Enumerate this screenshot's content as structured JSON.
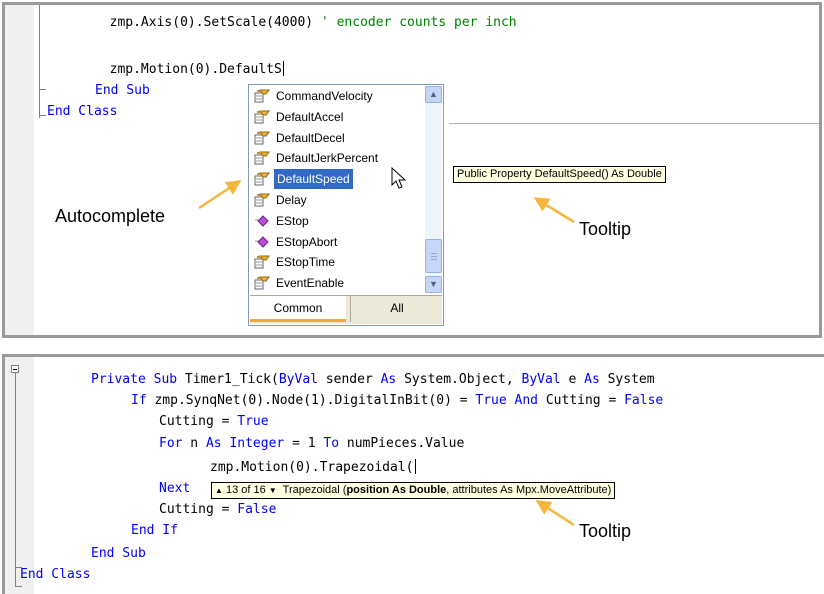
{
  "panel1": {
    "lines": [
      {
        "indent": "        ",
        "code": "zmp.Axis(0).SetScale(4000) ",
        "comment": "' encoder counts per inch"
      },
      {
        "indent": "        ",
        "code": "zmp.Motion(0).DefaultS",
        "comment": ""
      },
      {
        "kw": "End Sub"
      },
      {
        "kw": "End Class"
      }
    ],
    "autocomplete": {
      "items": [
        "CommandVelocity",
        "DefaultAccel",
        "DefaultDecel",
        "DefaultJerkPercent",
        "DefaultSpeed",
        "Delay",
        "EStop",
        "EStopAbort",
        "EStopTime",
        "EventEnable"
      ],
      "icons": [
        "property-icon",
        "property-icon",
        "property-icon",
        "property-icon",
        "property-icon",
        "property-icon",
        "method-icon",
        "method-icon",
        "property-icon",
        "property-icon"
      ],
      "selected": "DefaultSpeed",
      "tabs": [
        "Common",
        "All"
      ]
    },
    "tooltip": "Public Property DefaultSpeed() As Double",
    "callouts": {
      "autocomplete": "Autocomplete",
      "tooltip": "Tooltip"
    }
  },
  "panel2": {
    "l1": {
      "a": "Private Sub",
      "b": " Timer1_Tick(",
      "c": "ByVal",
      "d": " sender ",
      "e": "As",
      "f": " System.Object, ",
      "g": "ByVal",
      "h": " e ",
      "i": "As",
      "j": " System"
    },
    "l2": {
      "a": "If",
      "b": " zmp.SynqNet(0).Node(1).DigitalInBit(0) = ",
      "c": "True",
      "d": " ",
      "e": "And",
      "f": " Cutting = ",
      "g": "False"
    },
    "l3": {
      "a": "Cutting = ",
      "b": "True"
    },
    "l4": {
      "a": "For",
      "b": " n ",
      "c": "As",
      "d": " ",
      "e": "Integer",
      "f": " = 1 ",
      "g": "To",
      "h": " numPieces.Value"
    },
    "l5": {
      "a": "zmp.Motion(0).Trapezoidal("
    },
    "l6": {
      "a": "Next"
    },
    "l7": {
      "a": "Cutting = ",
      "b": "False"
    },
    "l8": {
      "a": "End If"
    },
    "l9": {
      "a": "End Sub"
    },
    "l10": {
      "a": "End Class"
    },
    "tooltip": {
      "counter": "13 of 16",
      "name": "Trapezoidal (",
      "bold": "position As Double",
      "rest": ", attributes As Mpx.MoveAttribute)"
    },
    "callout": "Tooltip"
  },
  "colors": {
    "keyword": "#0000ff",
    "comment": "#008000",
    "selection": "#316ac5",
    "tooltip_bg": "#ffffe1",
    "arrow": "#f6b53c",
    "tab_accent": "#f6a830"
  }
}
